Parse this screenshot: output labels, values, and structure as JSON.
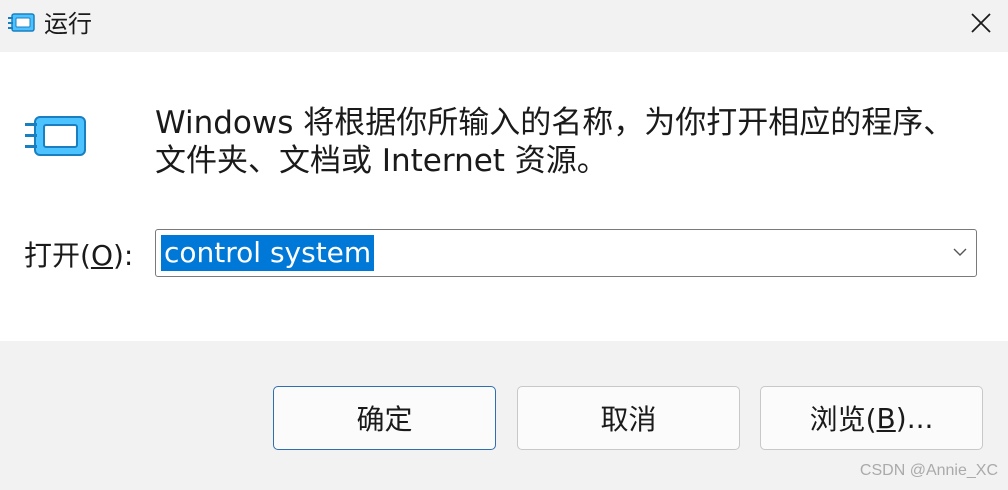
{
  "window": {
    "title": "运行",
    "title_icon": "run-dialog-icon",
    "close_icon": "close-icon"
  },
  "body": {
    "icon": "run-program-icon",
    "description": "Windows 将根据你所输入的名称，为你打开相应的程序、文件夹、文档或 Internet 资源。",
    "open_label_prefix": "打开(",
    "open_label_accel": "O",
    "open_label_suffix": "):",
    "input_value": "control system",
    "input_selected": true
  },
  "buttons": {
    "ok_label": "确定",
    "cancel_label": "取消",
    "browse_label_prefix": "浏览(",
    "browse_label_accel": "B",
    "browse_label_suffix": ")..."
  },
  "watermark": "CSDN @Annie_XC",
  "colors": {
    "selection": "#0078d7",
    "primary_border": "#2f6fb0",
    "footer_bg": "#f2f2f2"
  }
}
